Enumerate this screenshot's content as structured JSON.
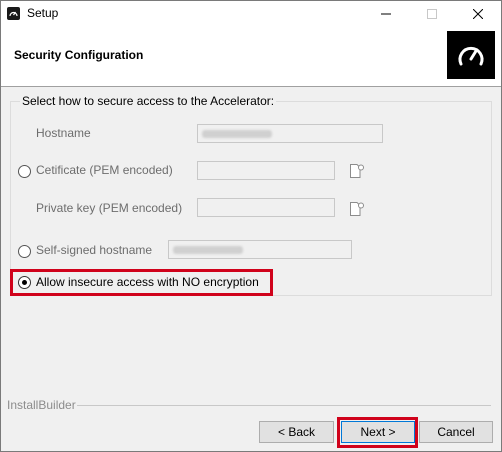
{
  "window": {
    "title": "Setup",
    "minimize_icon": "minimize-icon",
    "maximize_icon": "maximize-icon",
    "close_icon": "close-icon"
  },
  "header": {
    "title": "Security Configuration",
    "logo_icon": "speedometer-icon"
  },
  "form": {
    "group_title": "Select how to secure access to the Accelerator:",
    "hostname_label": "Hostname",
    "certificate_label": "Cetificate (PEM encoded)",
    "private_key_label": "Private key (PEM encoded)",
    "self_signed_label": "Self-signed hostname",
    "insecure_label": "Allow insecure access with NO encryption",
    "selected_option": "insecure"
  },
  "footer": {
    "brand": "InstallBuilder",
    "back_label": "< Back",
    "next_label": "Next >",
    "cancel_label": "Cancel"
  },
  "colors": {
    "highlight": "#d0021b",
    "logo_bg": "#000000"
  }
}
